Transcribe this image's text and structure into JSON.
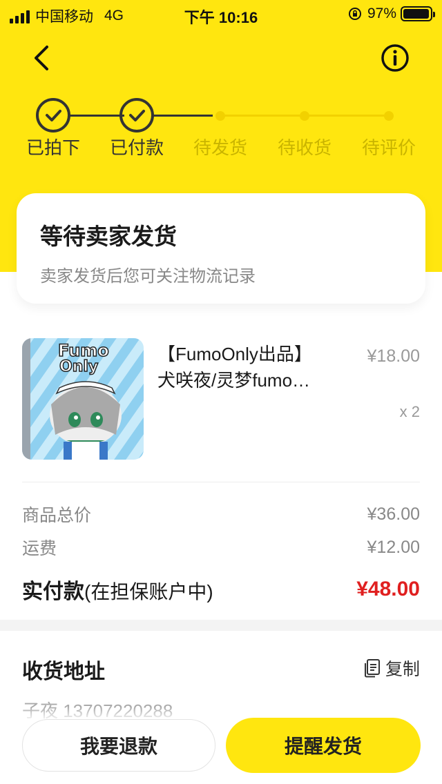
{
  "status_bar": {
    "carrier": "中国移动",
    "network": "4G",
    "time": "下午 10:16",
    "battery_percent": "97%",
    "battery_level": 0.97
  },
  "nav": {
    "back_icon": "chevron-left-icon",
    "info_icon": "info-icon"
  },
  "steps": [
    {
      "label": "已拍下",
      "state": "done"
    },
    {
      "label": "已付款",
      "state": "done"
    },
    {
      "label": "待发货",
      "state": "pending"
    },
    {
      "label": "待收货",
      "state": "pending"
    },
    {
      "label": "待评价",
      "state": "pending"
    }
  ],
  "status_card": {
    "title": "等待卖家发货",
    "subtitle": "卖家发货后您可关注物流记录"
  },
  "product": {
    "title_line1": "【FumoOnly出品】",
    "title_line2": "犬咲夜/灵梦fumo…",
    "price": "¥18.00",
    "quantity": "x 2",
    "thumb_text": "Fumo Only"
  },
  "summary": {
    "goods_total_label": "商品总价",
    "goods_total_value": "¥36.00",
    "shipping_label": "运费",
    "shipping_value": "¥12.00",
    "paid_label": "实付款",
    "paid_note": "(在担保账户中)",
    "paid_value": "¥48.00"
  },
  "address": {
    "title": "收货地址",
    "copy_label": "复制",
    "contact": "子夜 13707220288"
  },
  "actions": {
    "refund_label": "我要退款",
    "remind_label": "提醒发货"
  },
  "colors": {
    "brand_yellow": "#ffe60f",
    "price_red": "#e02020"
  }
}
